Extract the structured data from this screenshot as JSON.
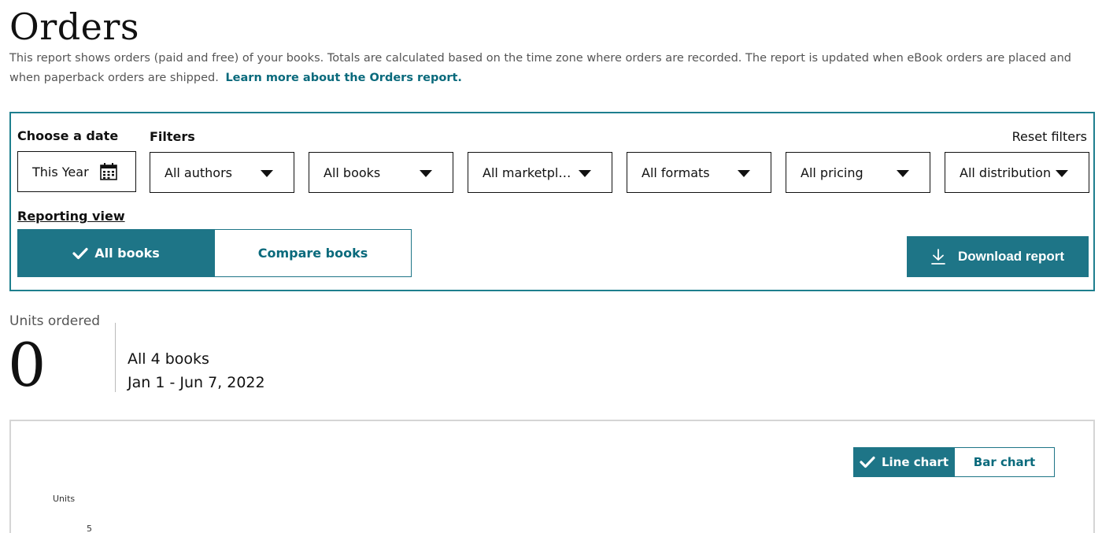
{
  "header": {
    "title": "Orders",
    "description": "This report shows orders (paid and free) of your books. Totals are calculated based on the time zone where orders are recorded. The report is updated when eBook orders are placed and when paperback orders are shipped.",
    "learn_more": "Learn more about the Orders report."
  },
  "filters": {
    "choose_date_label": "Choose a date",
    "date_value": "This Year",
    "filters_label": "Filters",
    "reset_label": "Reset filters",
    "dropdowns": [
      {
        "value": "All authors"
      },
      {
        "value": "All books"
      },
      {
        "value": "All marketplaces"
      },
      {
        "value": "All formats"
      },
      {
        "value": "All pricing"
      },
      {
        "value": "All distribution"
      }
    ],
    "reporting_view_label": "Reporting view",
    "view_all": "All books",
    "view_compare": "Compare books",
    "download_label": "Download report"
  },
  "summary": {
    "units_label": "Units ordered",
    "units_value": "0",
    "books_text": "All 4 books",
    "date_range": "Jan 1 - Jun 7, 2022"
  },
  "chart": {
    "line_label": "Line chart",
    "bar_label": "Bar chart",
    "axis_title": "Units",
    "tick_top": "5"
  },
  "colors": {
    "accent": "#1e7587",
    "link": "#0a6a7c"
  }
}
